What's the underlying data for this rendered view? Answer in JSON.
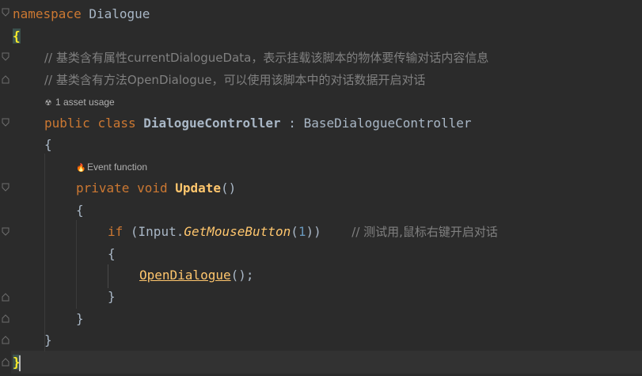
{
  "code": {
    "namespace_kw": "namespace",
    "namespace_name": "Dialogue",
    "open_brace": "{",
    "close_brace": "}",
    "comment_1": "// 基类含有属性currentDialogueData，表示挂载该脚本的物体要传输对话内容信息",
    "comment_2": "// 基类含有方法OpenDialogue，可以使用该脚本中的对话数据开启对话",
    "usage_hint": "1 asset usage",
    "class_public": "public",
    "class_kw": "class",
    "class_name": "DialogueController",
    "class_colon": ":",
    "class_base": "BaseDialogueController",
    "event_hint": "Event function",
    "method_private": "private",
    "method_void": "void",
    "method_name": "Update",
    "method_parens": "()",
    "if_kw": "if",
    "if_open": "(Input.",
    "if_call": "GetMouseButton",
    "if_paren_open": "(",
    "if_num": "1",
    "if_close": "))",
    "if_comment": "// 测试用,鼠标右键开启对话",
    "call_name": "OpenDialogue",
    "call_tail": "();"
  },
  "icons": {
    "usage": "radioactive-icon",
    "event": "flame-icon"
  },
  "colors": {
    "background": "#2b2b2b",
    "keyword": "#cc7832",
    "function": "#ffc66d",
    "number": "#6897bb",
    "comment": "#808080",
    "text": "#a9b7c6",
    "matched_brace": "#ffef28"
  }
}
